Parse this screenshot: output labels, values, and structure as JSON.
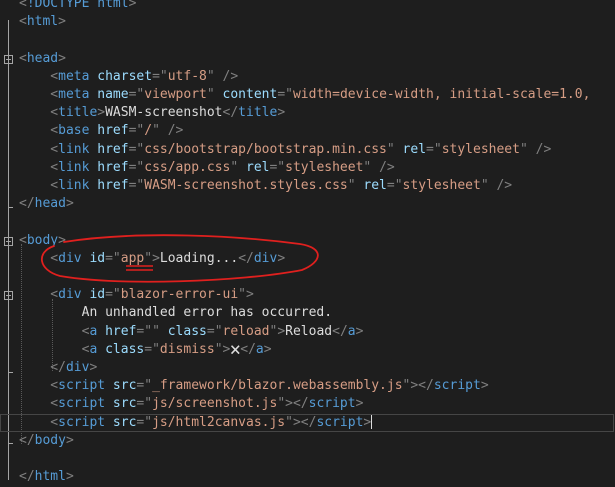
{
  "lines": [
    [
      [
        "br",
        "<"
      ],
      [
        "tag",
        "!DOCTYPE html"
      ],
      [
        "br",
        ">"
      ]
    ],
    [
      [
        "br",
        "<"
      ],
      [
        "tag",
        "html"
      ],
      [
        "br",
        ">"
      ]
    ],
    [],
    [
      [
        "br",
        "<"
      ],
      [
        "tag",
        "head"
      ],
      [
        "br",
        ">"
      ]
    ],
    [
      [
        "br",
        "    <"
      ],
      [
        "tag",
        "meta"
      ],
      [
        "attr",
        " charset"
      ],
      [
        "br",
        "=\""
      ],
      [
        "val",
        "utf-8"
      ],
      [
        "br",
        "\" />"
      ]
    ],
    [
      [
        "br",
        "    <"
      ],
      [
        "tag",
        "meta"
      ],
      [
        "attr",
        " name"
      ],
      [
        "br",
        "=\""
      ],
      [
        "val",
        "viewport"
      ],
      [
        "br",
        "\" "
      ],
      [
        "attr",
        "content"
      ],
      [
        "br",
        "=\""
      ],
      [
        "val",
        "width=device-width, initial-scale=1.0,"
      ]
    ],
    [
      [
        "br",
        "    <"
      ],
      [
        "tag",
        "title"
      ],
      [
        "br",
        ">"
      ],
      [
        "txt",
        "WASM-screenshot"
      ],
      [
        "br",
        "</"
      ],
      [
        "tag",
        "title"
      ],
      [
        "br",
        ">"
      ]
    ],
    [
      [
        "br",
        "    <"
      ],
      [
        "tag",
        "base"
      ],
      [
        "attr",
        " href"
      ],
      [
        "br",
        "=\""
      ],
      [
        "val",
        "/"
      ],
      [
        "br",
        "\" />"
      ]
    ],
    [
      [
        "br",
        "    <"
      ],
      [
        "tag",
        "link"
      ],
      [
        "attr",
        " href"
      ],
      [
        "br",
        "=\""
      ],
      [
        "val",
        "css/bootstrap/bootstrap.min.css"
      ],
      [
        "br",
        "\" "
      ],
      [
        "attr",
        "rel"
      ],
      [
        "br",
        "=\""
      ],
      [
        "val",
        "stylesheet"
      ],
      [
        "br",
        "\" />"
      ]
    ],
    [
      [
        "br",
        "    <"
      ],
      [
        "tag",
        "link"
      ],
      [
        "attr",
        " href"
      ],
      [
        "br",
        "=\""
      ],
      [
        "val",
        "css/app.css"
      ],
      [
        "br",
        "\" "
      ],
      [
        "attr",
        "rel"
      ],
      [
        "br",
        "=\""
      ],
      [
        "val",
        "stylesheet"
      ],
      [
        "br",
        "\" />"
      ]
    ],
    [
      [
        "br",
        "    <"
      ],
      [
        "tag",
        "link"
      ],
      [
        "attr",
        " href"
      ],
      [
        "br",
        "=\""
      ],
      [
        "val",
        "WASM-screenshot.styles.css"
      ],
      [
        "br",
        "\" "
      ],
      [
        "attr",
        "rel"
      ],
      [
        "br",
        "=\""
      ],
      [
        "val",
        "stylesheet"
      ],
      [
        "br",
        "\" />"
      ]
    ],
    [
      [
        "br",
        "</"
      ],
      [
        "tag",
        "head"
      ],
      [
        "br",
        ">"
      ]
    ],
    [],
    [
      [
        "br",
        "<"
      ],
      [
        "tag",
        "body"
      ],
      [
        "br",
        ">"
      ]
    ],
    [
      [
        "br",
        "    <"
      ],
      [
        "tag",
        "div"
      ],
      [
        "attr",
        " id"
      ],
      [
        "br",
        "=\""
      ],
      [
        "val",
        "app"
      ],
      [
        "br",
        "\">"
      ],
      [
        "txt",
        "Loading..."
      ],
      [
        "br",
        "</"
      ],
      [
        "tag",
        "div"
      ],
      [
        "br",
        ">"
      ]
    ],
    [],
    [
      [
        "br",
        "    <"
      ],
      [
        "tag",
        "div"
      ],
      [
        "attr",
        " id"
      ],
      [
        "br",
        "=\""
      ],
      [
        "val",
        "blazor-error-ui"
      ],
      [
        "br",
        "\">"
      ]
    ],
    [
      [
        "txt",
        "        An unhandled error has occurred."
      ]
    ],
    [
      [
        "br",
        "        <"
      ],
      [
        "tag",
        "a"
      ],
      [
        "attr",
        " href"
      ],
      [
        "br",
        "=\"\" "
      ],
      [
        "attr",
        "class"
      ],
      [
        "br",
        "=\""
      ],
      [
        "val",
        "reload"
      ],
      [
        "br",
        "\">"
      ],
      [
        "txt",
        "Reload"
      ],
      [
        "br",
        "</"
      ],
      [
        "tag",
        "a"
      ],
      [
        "br",
        ">"
      ]
    ],
    [
      [
        "br",
        "        <"
      ],
      [
        "tag",
        "a"
      ],
      [
        "attr",
        " class"
      ],
      [
        "br",
        "=\""
      ],
      [
        "val",
        "dismiss"
      ],
      [
        "br",
        "\">"
      ],
      [
        "txt",
        "🗙"
      ],
      [
        "br",
        "</"
      ],
      [
        "tag",
        "a"
      ],
      [
        "br",
        ">"
      ]
    ],
    [
      [
        "br",
        "    </"
      ],
      [
        "tag",
        "div"
      ],
      [
        "br",
        ">"
      ]
    ],
    [
      [
        "br",
        "    <"
      ],
      [
        "tag",
        "script"
      ],
      [
        "attr",
        " src"
      ],
      [
        "br",
        "=\""
      ],
      [
        "val",
        "_framework/blazor.webassembly.js"
      ],
      [
        "br",
        "\"></"
      ],
      [
        "tag",
        "script"
      ],
      [
        "br",
        ">"
      ]
    ],
    [
      [
        "br",
        "    <"
      ],
      [
        "tag",
        "script"
      ],
      [
        "attr",
        " src"
      ],
      [
        "br",
        "=\""
      ],
      [
        "val",
        "js/screenshot.js"
      ],
      [
        "br",
        "\"></"
      ],
      [
        "tag",
        "script"
      ],
      [
        "br",
        ">"
      ]
    ],
    [
      [
        "br",
        "    <"
      ],
      [
        "tag",
        "script"
      ],
      [
        "attr",
        " src"
      ],
      [
        "br",
        "=\""
      ],
      [
        "val",
        "js/html2canvas.js"
      ],
      [
        "br",
        "\"></"
      ],
      [
        "tag",
        "script"
      ],
      [
        "br",
        ">"
      ]
    ],
    [
      [
        "br",
        "</"
      ],
      [
        "tag",
        "body"
      ],
      [
        "br",
        ">"
      ]
    ],
    [],
    [
      [
        "br",
        "</"
      ],
      [
        "tag",
        "html"
      ],
      [
        "br",
        ">"
      ]
    ]
  ],
  "current_line": 23,
  "fold_markers": [
    3,
    13,
    16
  ],
  "colors": {
    "background": "#1e1e1e",
    "tag": "#569cd6",
    "attribute": "#9cdcfe",
    "value": "#d69d85",
    "bracket": "#808080",
    "annotation": "#e0201e"
  },
  "icons": [
    "collapse-icon",
    "dismiss-x-icon"
  ]
}
